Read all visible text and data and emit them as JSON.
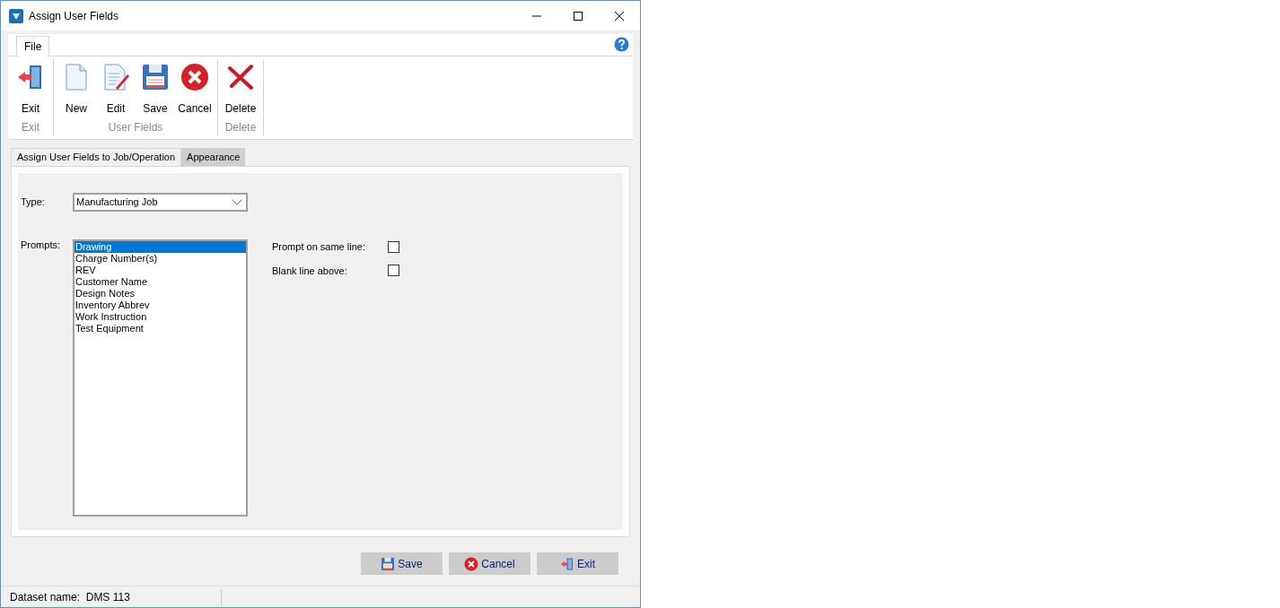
{
  "window": {
    "title": "Assign User Fields"
  },
  "ribbon_tabs": [
    {
      "label": "File",
      "selected": true
    }
  ],
  "ribbon_groups": [
    {
      "label": "Exit",
      "buttons": [
        {
          "label": "Exit",
          "kind": "exit"
        }
      ]
    },
    {
      "label": "User Fields",
      "buttons": [
        {
          "label": "New",
          "kind": "new"
        },
        {
          "label": "Edit",
          "kind": "edit"
        },
        {
          "label": "Save",
          "kind": "save"
        },
        {
          "label": "Cancel",
          "kind": "cancel"
        }
      ]
    },
    {
      "label": "Delete",
      "buttons": [
        {
          "label": "Delete",
          "kind": "delete"
        }
      ]
    }
  ],
  "tabs": [
    {
      "label": "Assign User Fields to Job/Operation",
      "selected": true
    },
    {
      "label": "Appearance",
      "selected": false
    }
  ],
  "type_field": {
    "label": "Type:",
    "value": "Manufacturing Job"
  },
  "prompts": {
    "label": "Prompts:",
    "items": [
      {
        "label": "Drawing",
        "selected": true
      },
      {
        "label": "Charge Number(s)",
        "selected": false
      },
      {
        "label": "REV",
        "selected": false
      },
      {
        "label": "Customer Name",
        "selected": false
      },
      {
        "label": "Design Notes",
        "selected": false
      },
      {
        "label": "Inventory Abbrev",
        "selected": false
      },
      {
        "label": "Work Instruction",
        "selected": false
      },
      {
        "label": "Test Equipment",
        "selected": false
      }
    ]
  },
  "options": [
    {
      "label": "Prompt on same line:",
      "checked": false
    },
    {
      "label": "Blank line above:",
      "checked": false
    }
  ],
  "buttons": [
    {
      "label": "Save",
      "kind": "save"
    },
    {
      "label": "Cancel",
      "kind": "cancel"
    },
    {
      "label": "Exit",
      "kind": "exit"
    }
  ],
  "status_bar": {
    "text": "Dataset name:  DMS 113"
  }
}
